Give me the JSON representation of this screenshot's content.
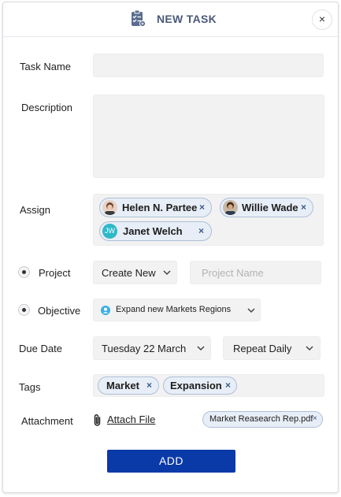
{
  "header": {
    "title": "NEW TASK",
    "close_label": "×",
    "icon": "clipboard-icon"
  },
  "form": {
    "task_name_label": "Task Name",
    "description_label": "Description",
    "assign_label": "Assign",
    "project_label": "Project",
    "objective_label": "Objective",
    "due_date_label": "Due Date",
    "tags_label": "Tags",
    "attachment_label": "Attachment"
  },
  "assignees": [
    {
      "name": "Helen N. Partee",
      "remove": "×"
    },
    {
      "name": "Willie Wade",
      "remove": "×"
    },
    {
      "name": "Janet Welch",
      "initials": "JW",
      "remove": "×"
    }
  ],
  "project": {
    "select_value": "Create New",
    "name_placeholder": "Project Name"
  },
  "objective": {
    "value": "Expand new Markets Regions"
  },
  "due_date": {
    "date_value": "Tuesday 22 March",
    "repeat_value": "Repeat Daily"
  },
  "tags": [
    {
      "label": "Market",
      "remove": "×"
    },
    {
      "label": "Expansion",
      "remove": "×"
    }
  ],
  "attachment": {
    "link_text": "Attach File",
    "file_name": "Market Reasearch Rep.pdf",
    "remove": "×"
  },
  "submit_label": "ADD",
  "colors": {
    "primary": "#0a3aa8",
    "chip_bg": "#e8eef7",
    "chip_border": "#aebfd6",
    "avatar_teal": "#2fb8c8"
  }
}
